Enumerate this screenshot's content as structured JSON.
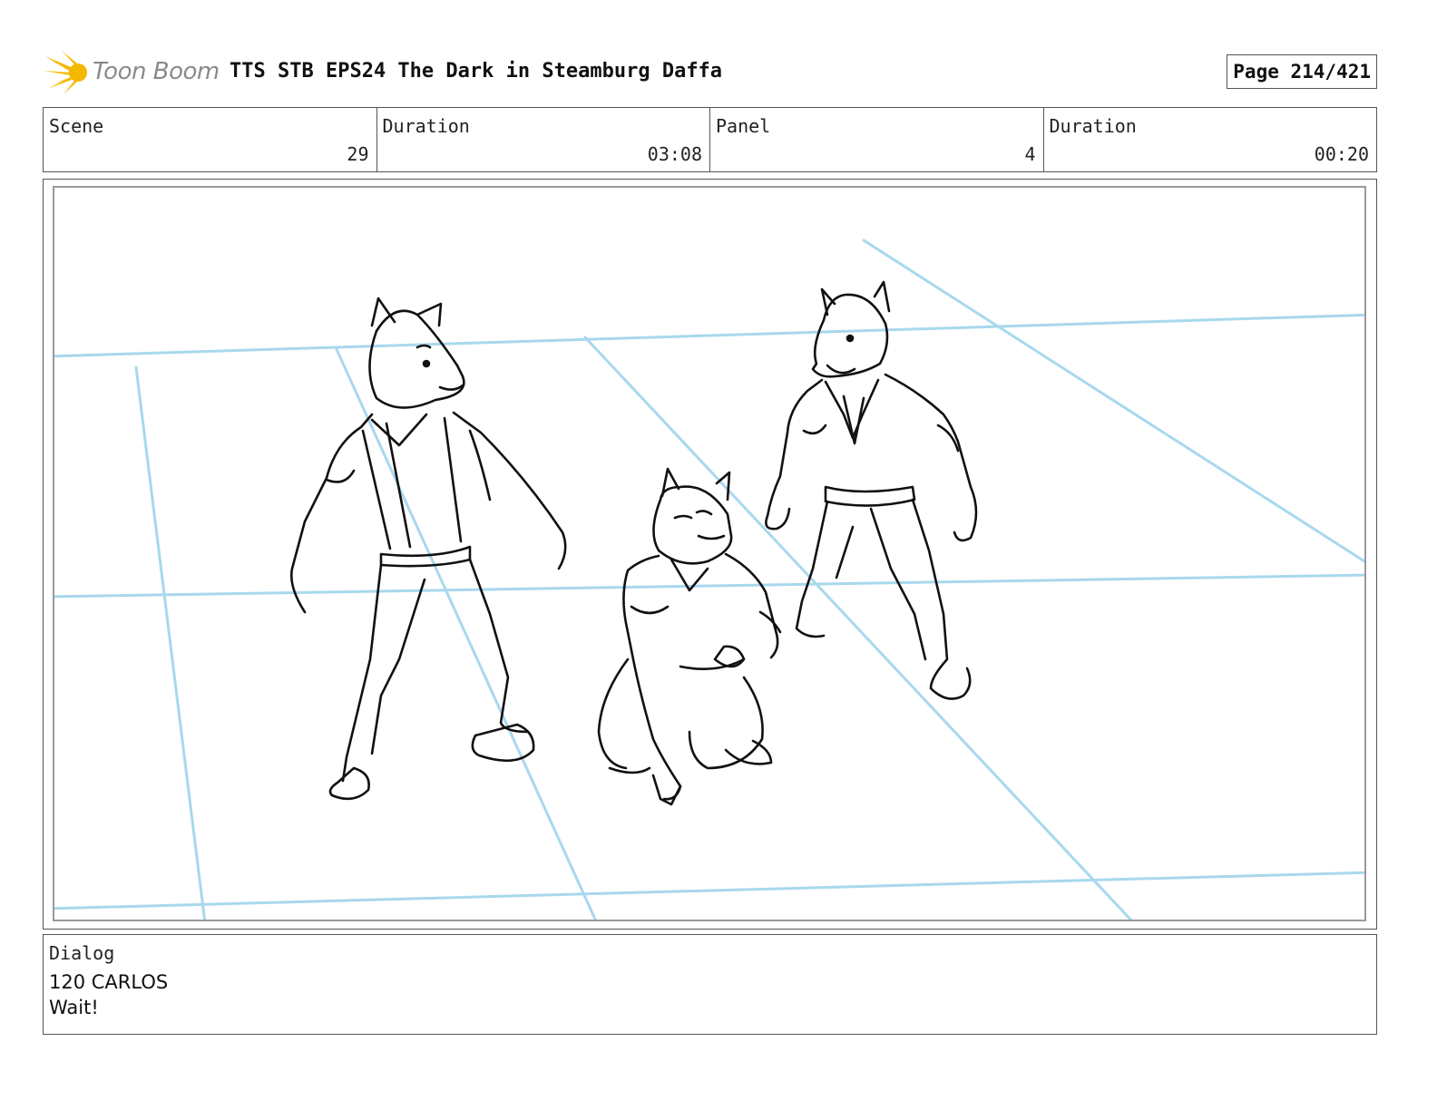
{
  "header": {
    "logo_text": "Toon Boom",
    "title": "TTS STB EPS24 The Dark in Steamburg Daffa",
    "page": "Page 214/421"
  },
  "info": {
    "scene_label": "Scene",
    "scene_value": "29",
    "scene_duration_label": "Duration",
    "scene_duration_value": "03:08",
    "panel_label": "Panel",
    "panel_value": "4",
    "panel_duration_label": "Duration",
    "panel_duration_value": "00:20"
  },
  "dialog": {
    "label": "Dialog",
    "lines": [
      "120 CARLOS",
      "Wait!"
    ]
  },
  "colors": {
    "guide_lines": "#a8d8ee",
    "ink": "#111111",
    "logo_accent": "#f5b800"
  }
}
